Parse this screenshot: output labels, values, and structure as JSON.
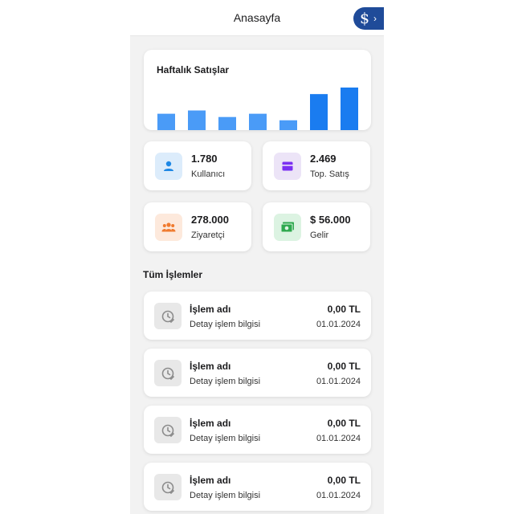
{
  "header": {
    "title": "Anasayfa",
    "brand_icon": "dollar-sign-icon",
    "brand_color": "#1f4b99"
  },
  "chart_card": {
    "title": "Haftalık Satışlar"
  },
  "chart_data": {
    "type": "bar",
    "values": [
      5,
      6,
      4,
      5,
      3,
      11,
      13
    ],
    "colors": [
      "#4a9bf7",
      "#4a9bf7",
      "#4a9bf7",
      "#4a9bf7",
      "#4a9bf7",
      "#1a7cf0",
      "#1a7cf0"
    ],
    "grid": false,
    "legend": "none"
  },
  "stats": [
    {
      "value": "1.780",
      "label": "Kullanıcı",
      "icon": "user-icon",
      "bg": "#dcecfb",
      "fg": "#1e88e5"
    },
    {
      "value": "2.469",
      "label": "Top. Satış",
      "icon": "wallet-icon",
      "bg": "#ece4f7",
      "fg": "#7b2ff2"
    },
    {
      "value": "278.000",
      "label": "Ziyaretçi",
      "icon": "group-icon",
      "bg": "#fde9dc",
      "fg": "#f07a2e"
    },
    {
      "value": "$ 56.000",
      "label": "Gelir",
      "icon": "money-icon",
      "bg": "#dcf3e2",
      "fg": "#2fa84f"
    }
  ],
  "transactions": {
    "title": "Tüm İşlemler",
    "items": [
      {
        "name": "İşlem adı",
        "detail": "Detay işlem bilgisi",
        "amount": "0,00 TL",
        "date": "01.01.2024"
      },
      {
        "name": "İşlem adı",
        "detail": "Detay işlem bilgisi",
        "amount": "0,00 TL",
        "date": "01.01.2024"
      },
      {
        "name": "İşlem adı",
        "detail": "Detay işlem bilgisi",
        "amount": "0,00 TL",
        "date": "01.01.2024"
      },
      {
        "name": "İşlem adı",
        "detail": "Detay işlem bilgisi",
        "amount": "0,00 TL",
        "date": "01.01.2024"
      }
    ]
  }
}
